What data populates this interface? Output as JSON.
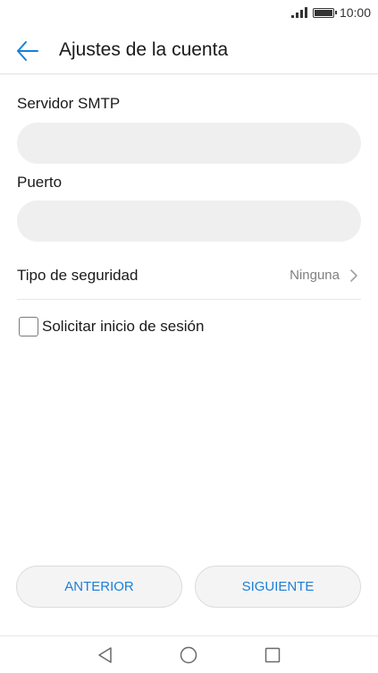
{
  "status_bar": {
    "time": "10:00",
    "signal_icon": "signal-icon",
    "battery_icon": "battery-icon"
  },
  "header": {
    "title": "Ajustes de la cuenta",
    "back_icon": "back-arrow-icon",
    "accent_color": "#1a7fd9"
  },
  "form": {
    "smtp_server": {
      "label": "Servidor SMTP",
      "value": "",
      "placeholder": ""
    },
    "port": {
      "label": "Puerto",
      "value": "",
      "placeholder": ""
    },
    "security_type": {
      "label": "Tipo de seguridad",
      "value": "Ninguna",
      "chevron_icon": "chevron-right-icon"
    },
    "require_signin": {
      "label": "Solicitar inicio de sesión",
      "checked": false
    }
  },
  "buttons": {
    "previous": "ANTERIOR",
    "next": "SIGUIENTE"
  },
  "nav_bar": {
    "back_icon": "nav-back-icon",
    "home_icon": "nav-home-icon",
    "recents_icon": "nav-recents-icon"
  }
}
